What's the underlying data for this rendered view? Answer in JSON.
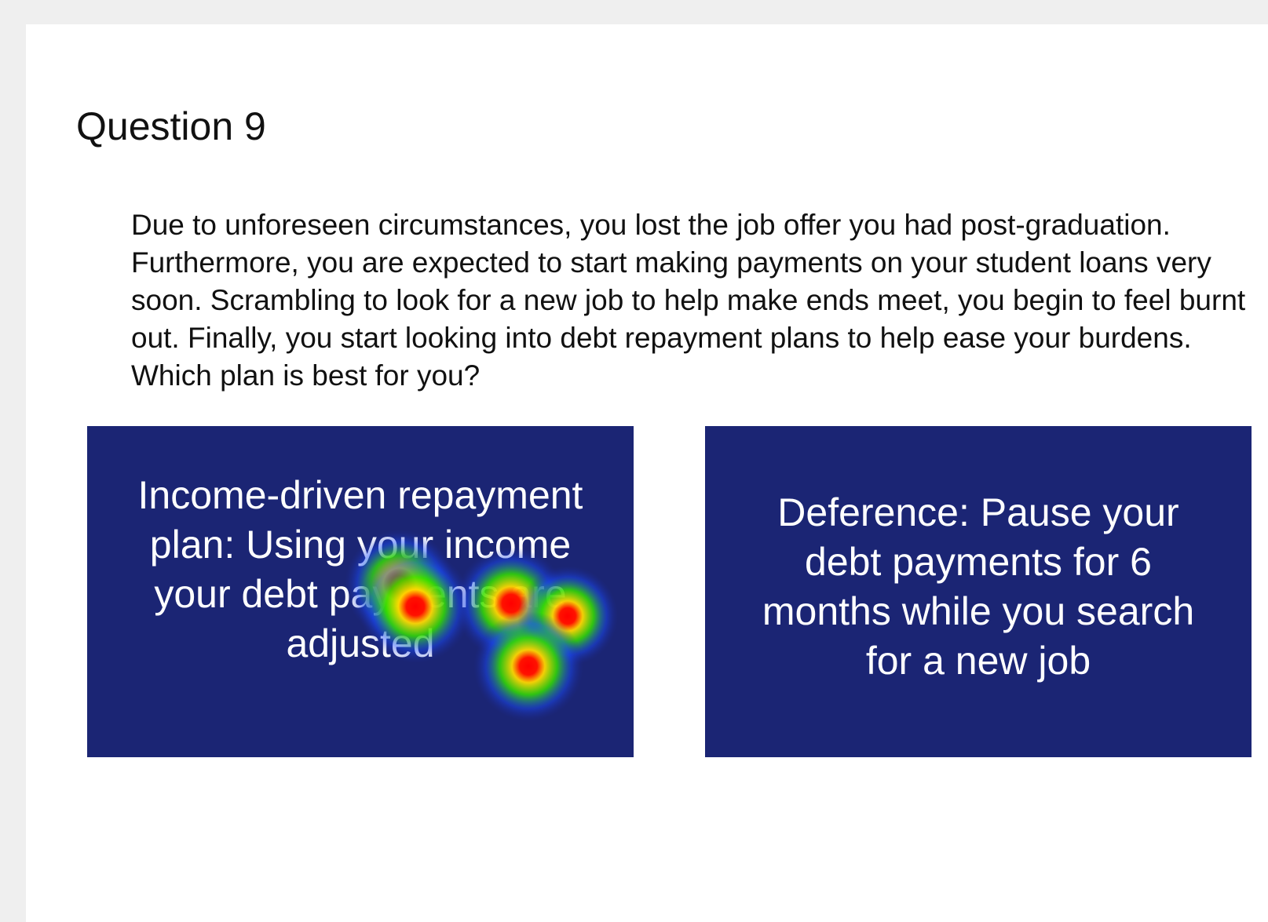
{
  "question": {
    "title": "Question 9",
    "text": "Due to unforeseen circumstances, you lost the job offer you had post-graduation. Furthermore, you are expected to start making payments on your student loans very soon. Scrambling to look for a new job to help make ends meet, you begin to feel burnt out. Finally, you start looking into debt repayment plans to help ease your burdens. Which plan is best for you?"
  },
  "options": [
    {
      "label": "Income-driven repayment plan: Using your income your debt payments are adjusted"
    },
    {
      "label": "Deference: Pause your debt payments for 6 months while you search for a new job"
    }
  ],
  "colors": {
    "page_background": "#efefef",
    "card_background": "#1b2574",
    "card_text": "#ffffff",
    "heat_low": "#1a3cff",
    "heat_mid": "#19e000",
    "heat_high": "#ffe600",
    "heat_peak": "#ff0000"
  }
}
